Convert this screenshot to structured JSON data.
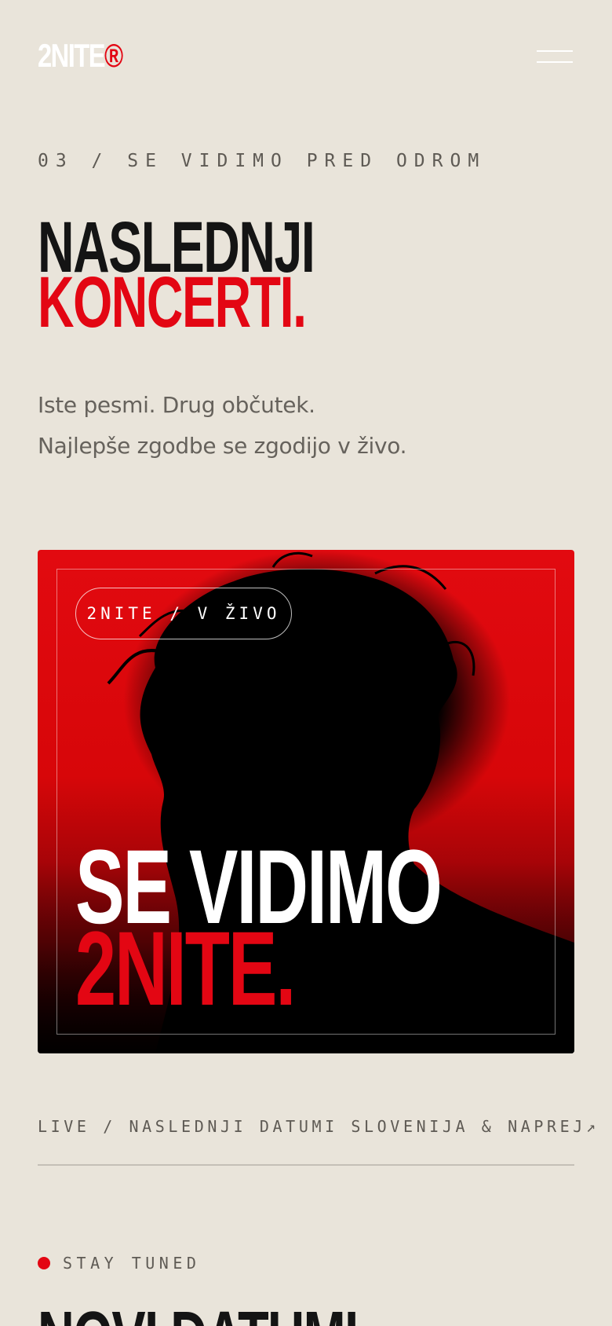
{
  "header": {
    "logo_text": "2NITE",
    "logo_mark": "®",
    "menu_icon": "hamburger-menu-icon"
  },
  "section": {
    "eyebrow": "03 / SE VIDIMO PRED ODROM",
    "headline_line1": "NASLEDNJI",
    "headline_line2": "KONCERTI.",
    "lead_line1": "Iste pesmi. Drug občutek.",
    "lead_line2": "Najlepše zgodbe se zgodijo v živo."
  },
  "hero_card": {
    "pill_label": "2NITE / V ŽIVO",
    "title_line1": "SE VIDIMO",
    "title_line2": "2NITE.",
    "image": "performer-silhouette-red-backlight"
  },
  "live_link": {
    "label": "LIVE / NASLEDNJI DATUMI SLOVENIJA & NAPREJ",
    "arrow": "↗"
  },
  "stay_tuned": {
    "label": "STAY TUNED",
    "next_title": "NOVI DATUMI"
  },
  "colors": {
    "background": "#e9e4da",
    "accent": "#e30613",
    "text_dark": "#141414",
    "text_muted": "#5e5a54"
  }
}
